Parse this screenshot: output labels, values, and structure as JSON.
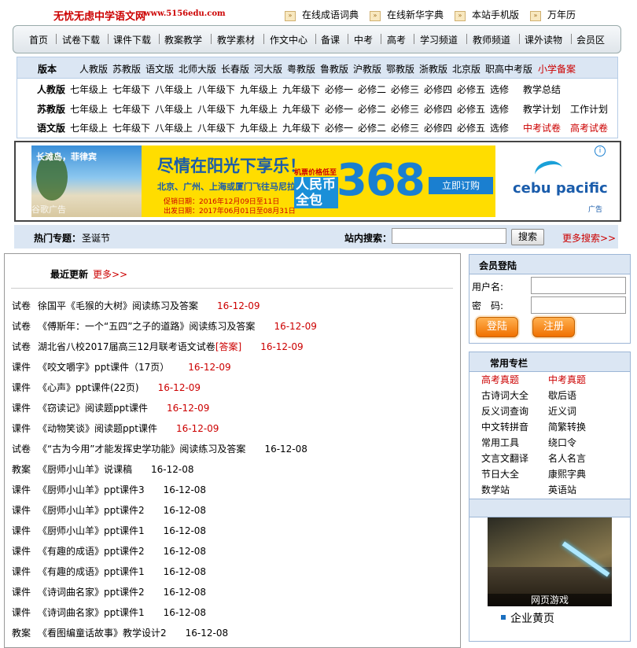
{
  "top": {
    "site_name": "无忧无虑中学语文网",
    "site_url": "www.5156edu.com",
    "links": [
      "在线成语词典",
      "在线新华字典",
      "本站手机版",
      "万年历"
    ]
  },
  "nav": [
    "首页",
    "试卷下载",
    "课件下载",
    "教案教学",
    "教学素材",
    "作文中心",
    "备课",
    "中考",
    "高考",
    "学习频道",
    "教师频道",
    "课外读物",
    "会员区"
  ],
  "versions": {
    "header_label": "版本",
    "header_items": [
      "人教版",
      "苏教版",
      "语文版",
      "北师大版",
      "长春版",
      "河大版",
      "粤教版",
      "鲁教版",
      "沪教版",
      "鄂教版",
      "浙教版",
      "北京版",
      "职高中考版"
    ],
    "header_red": "小学备案",
    "grades": [
      "七年级上",
      "七年级下",
      "八年级上",
      "八年级下",
      "九年级上",
      "九年级下",
      "必修一",
      "必修二",
      "必修三",
      "必修四",
      "必修五",
      "选修"
    ],
    "rows": [
      {
        "label": "人教版",
        "extra": [
          "教学总结"
        ]
      },
      {
        "label": "苏教版",
        "extra": [
          "教学计划",
          "工作计划"
        ]
      },
      {
        "label": "语文版",
        "extra": [
          "中考试卷",
          "高考试卷"
        ]
      }
    ]
  },
  "ad": {
    "photo_text": "长滩岛，菲律宾",
    "photo_foot": "谷歌广告",
    "slogan": "尽情在阳光下享乐！",
    "cities": "北京、广州、上海或厦门飞往马尼拉",
    "date1": "促销日期：2016年12月09日至11日",
    "date2": "出发日期：2017年06月01日至08月31日",
    "price_label": "机票价格低至",
    "rmb": "人民币 全包",
    "price": "368",
    "button": "立即订购",
    "brand": "cebu pacific",
    "ad_label": "广告",
    "info": "i"
  },
  "hot": {
    "label": "热门专题：",
    "item": "圣诞节",
    "search_label": "站内搜索：",
    "search_value": "",
    "search_button": "搜索",
    "more_search": "更多搜索>>"
  },
  "updates": {
    "title": "最近更新",
    "more": "更多>>",
    "items": [
      {
        "cat": "试卷",
        "title": "徐国平《毛猴的大树》阅读练习及答案",
        "date": "16-12-09",
        "recent": true
      },
      {
        "cat": "试卷",
        "title": "《傅斯年：一个“五四”之子的道路》阅读练习及答案",
        "date": "16-12-09",
        "recent": true
      },
      {
        "cat": "试卷",
        "title": "湖北省八校2017届高三12月联考语文试卷",
        "tag": "[答案]",
        "date": "16-12-09",
        "recent": true
      },
      {
        "cat": "课件",
        "title": "《咬文嚼字》ppt课件（17页）",
        "date": "16-12-09",
        "recent": true
      },
      {
        "cat": "课件",
        "title": "《心声》ppt课件(22页)",
        "date": "16-12-09",
        "recent": true
      },
      {
        "cat": "课件",
        "title": "《窃读记》阅读题ppt课件",
        "date": "16-12-09",
        "recent": true
      },
      {
        "cat": "课件",
        "title": "《动物笑谈》阅读题ppt课件",
        "date": "16-12-09",
        "recent": true
      },
      {
        "cat": "试卷",
        "title": "《“古为今用”才能发挥史学功能》阅读练习及答案",
        "date": "16-12-08",
        "recent": false
      },
      {
        "cat": "教案",
        "title": "《厨师小山羊》说课稿",
        "date": "16-12-08",
        "recent": false
      },
      {
        "cat": "课件",
        "title": "《厨师小山羊》ppt课件3",
        "date": "16-12-08",
        "recent": false
      },
      {
        "cat": "课件",
        "title": "《厨师小山羊》ppt课件2",
        "date": "16-12-08",
        "recent": false
      },
      {
        "cat": "课件",
        "title": "《厨师小山羊》ppt课件1",
        "date": "16-12-08",
        "recent": false
      },
      {
        "cat": "课件",
        "title": "《有趣的成语》ppt课件2",
        "date": "16-12-08",
        "recent": false
      },
      {
        "cat": "课件",
        "title": "《有趣的成语》ppt课件1",
        "date": "16-12-08",
        "recent": false
      },
      {
        "cat": "课件",
        "title": "《诗词曲名家》ppt课件2",
        "date": "16-12-08",
        "recent": false
      },
      {
        "cat": "课件",
        "title": "《诗词曲名家》ppt课件1",
        "date": "16-12-08",
        "recent": false
      },
      {
        "cat": "教案",
        "title": "《看图编童话故事》教学设计2",
        "date": "16-12-08",
        "recent": false
      }
    ]
  },
  "login": {
    "title": "会员登陆",
    "user_label": "用户名:",
    "pass_label": "密　码:",
    "login_btn": "登陆",
    "register_btn": "注册"
  },
  "common": {
    "title": "常用专栏",
    "items": [
      [
        "高考真题",
        "中考真题"
      ],
      [
        "古诗词大全",
        "歇后语"
      ],
      [
        "反义词查询",
        "近义词"
      ],
      [
        "中文转拼音",
        "简繁转换"
      ],
      [
        "常用工具",
        "绕口令"
      ],
      [
        "文言文翻译",
        "名人名言"
      ],
      [
        "节日大全",
        "康熙字典"
      ],
      [
        "数学站",
        "英语站"
      ]
    ]
  },
  "game": {
    "caption": "网页游戏",
    "list_item": "企业黄页"
  },
  "colors": {
    "accent_red": "#cc0000",
    "panel_blue": "#dbe6f3",
    "border_blue": "#9db6d6"
  }
}
